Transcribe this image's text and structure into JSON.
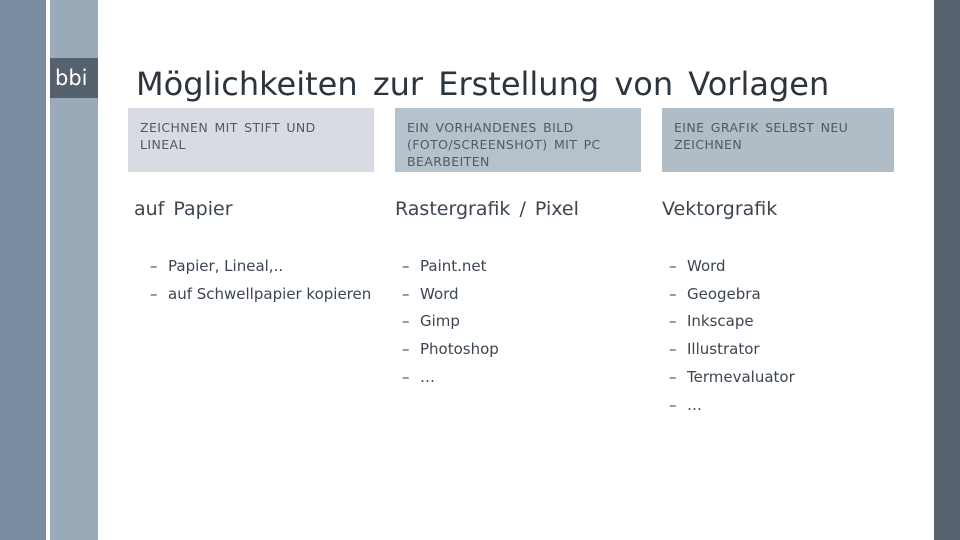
{
  "slide": {
    "title": "Möglichkeiten zur Erstellung von Vorlagen",
    "logo": "bbi",
    "colors": {
      "bar_outer": "#798ca0",
      "bar_inner": "#9aaab8",
      "bar_right": "#57636f",
      "logo_box": "#55626e",
      "title_text": "#2c343d",
      "caption_box_1": "#d8dce2",
      "caption_box_2": "#b5c1cb",
      "caption_box_3": "#b0bcc6",
      "body_text": "#3b4651"
    }
  },
  "columns": [
    {
      "caption": "ZEICHNEN MIT STIFT UND LINEAL",
      "subhead": "auf Papier",
      "bullet_marker": "–",
      "items": [
        "Papier, Lineal,..",
        "auf Schwellpapier kopieren"
      ]
    },
    {
      "caption": "EIN VORHANDENES BILD (FOTO/SCREENSHOT) MIT PC BEARBEITEN",
      "subhead": "Rastergrafik / Pixel",
      "bullet_marker": "–",
      "items": [
        "Paint.net",
        "Word",
        "Gimp",
        "Photoshop",
        "…"
      ]
    },
    {
      "caption": "EINE GRAFIK SELBST NEU ZEICHNEN",
      "subhead": "Vektorgrafik",
      "bullet_marker": "–",
      "items": [
        "Word",
        "Geogebra",
        "Inkscape",
        "Illustrator",
        "Termevaluator",
        "…"
      ]
    }
  ]
}
